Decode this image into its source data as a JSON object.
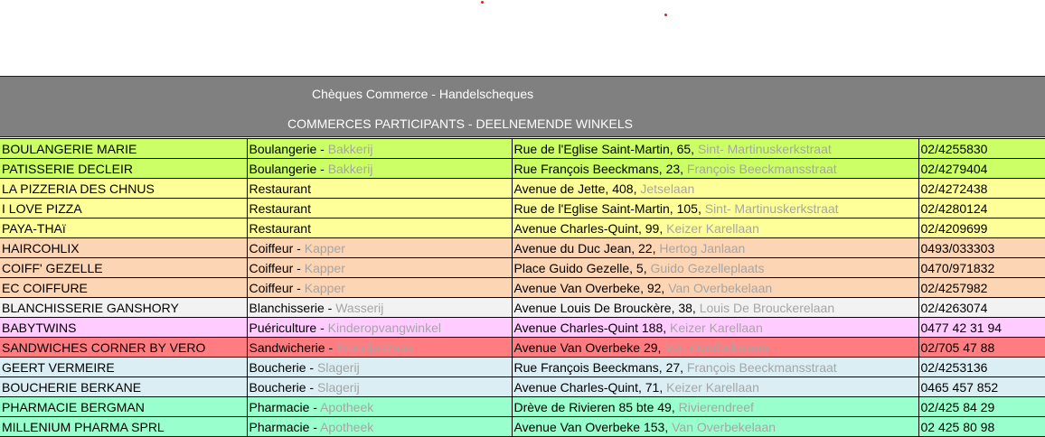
{
  "header": {
    "title": "Chèques Commerce - Handelscheques",
    "subtitle": "COMMERCES PARTICIPANTS - DEELNEMENDE WINKELS"
  },
  "rows": [
    {
      "name": "BOULANGERIE MARIE",
      "type_fr": "Boulangerie",
      "type_nl": "Bakkerij",
      "addr_fr": "Rue de l'Eglise Saint-Martin, 65,",
      "addr_nl": "Sint- Martinuskerkstraat",
      "phone": "02/4255830",
      "bg": "#ccff66"
    },
    {
      "name": "PATISSERIE DECLEIR",
      "type_fr": "Boulangerie",
      "type_nl": "Bakkerij",
      "addr_fr": "Rue François Beeckmans, 23,",
      "addr_nl": "François Beeckmansstraat",
      "phone": "02/4279404",
      "bg": "#ccff66"
    },
    {
      "name": "LA PIZZERIA DES CHNUS",
      "type_fr": "Restaurant",
      "type_nl": "",
      "addr_fr": "Avenue de Jette, 408,",
      "addr_nl": "Jetselaan",
      "phone": "02/4272438",
      "bg": "#ffff99"
    },
    {
      "name": "I LOVE PIZZA",
      "type_fr": "Restaurant",
      "type_nl": "",
      "addr_fr": "Rue de l'Eglise Saint-Martin, 105,",
      "addr_nl": "Sint- Martinuskerkstraat",
      "phone": "02/4280124",
      "bg": "#ffff99"
    },
    {
      "name": "PAYA-THAï",
      "type_fr": "Restaurant",
      "type_nl": "",
      "addr_fr": "Avenue Charles-Quint, 99,",
      "addr_nl": "Keizer Karellaan",
      "phone": "02/4209699",
      "bg": "#ffff99"
    },
    {
      "name": "HAIRCOHLIX",
      "type_fr": "Coiffeur",
      "type_nl": "Kapper",
      "addr_fr": "Avenue du Duc Jean, 22,",
      "addr_nl": "Hertog Janlaan",
      "phone": "0493/033303",
      "bg": "#fcd5b4"
    },
    {
      "name": "COIFF' GEZELLE",
      "type_fr": "Coiffeur",
      "type_nl": "Kapper",
      "addr_fr": "Place Guido Gezelle, 5,",
      "addr_nl": "Guido Gezelleplaats",
      "phone": "0470/971832",
      "bg": "#fcd5b4"
    },
    {
      "name": "EC COIFFURE",
      "type_fr": "Coiffeur",
      "type_nl": "Kapper",
      "addr_fr": "Avenue Van Overbeke, 92,",
      "addr_nl": "Van Overbekelaan",
      "phone": "02/4257982",
      "bg": "#fcd5b4"
    },
    {
      "name": "BLANCHISSERIE GANSHORY",
      "type_fr": "Blanchisserie",
      "type_nl": "Wasserij",
      "addr_fr": "Avenue Louis De Brouckère, 38,",
      "addr_nl": "Louis De Brouckerelaan",
      "phone": "02/4263074",
      "bg": "#f2f2f2"
    },
    {
      "name": "BABYTWINS",
      "type_fr": "Puériculture",
      "type_nl": "Kinderopvangwinkel",
      "addr_fr": "Avenue Charles-Quint 188,",
      "addr_nl": "Keizer Karellaan",
      "phone": "0477 42 31 94",
      "bg": "#ffccff"
    },
    {
      "name": "SANDWICHES CORNER BY VERO",
      "type_fr": "Sandwicherie",
      "type_nl": "Broodjeszaak",
      "addr_fr": "Avenue Van Overbeke 29,",
      "addr_nl": "Van Overbekelaan",
      "phone": "02/705 47 88",
      "bg": "#ff7c80"
    },
    {
      "name": "GEERT VERMEIRE",
      "type_fr": "Boucherie",
      "type_nl": "Slagerij",
      "addr_fr": "Rue François Beeckmans, 27,",
      "addr_nl": "François Beeckmansstraat",
      "phone": "02/4253136",
      "bg": "#daeef3"
    },
    {
      "name": "BOUCHERIE BERKANE",
      "type_fr": "Boucherie",
      "type_nl": "Slagerij",
      "addr_fr": "Avenue Charles-Quint, 71,",
      "addr_nl": "Keizer Karellaan",
      "phone": "0465 457 852",
      "bg": "#daeef3"
    },
    {
      "name": "PHARMACIE BERGMAN",
      "type_fr": "Pharmacie",
      "type_nl": "Apotheek",
      "addr_fr": "Drève de Rivieren 85 bte 49,",
      "addr_nl": "Rivierendreef",
      "phone": "02/425 84 29",
      "bg": "#99ffcc"
    },
    {
      "name": "MILLENIUM PHARMA SPRL",
      "type_fr": "Pharmacie",
      "type_nl": "Apotheek",
      "addr_fr": "Avenue Van Overbeke 153,",
      "addr_nl": "Van Overbekelaan",
      "phone": "02 425 80 98",
      "bg": "#99ffcc"
    }
  ]
}
